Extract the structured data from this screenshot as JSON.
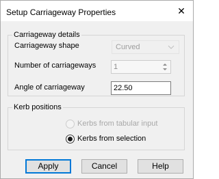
{
  "window": {
    "title": "Setup Carriageway Properties",
    "close_glyph": "✕"
  },
  "carriageway_details": {
    "legend": "Carriageway details",
    "shape_label": "Carriageway shape",
    "shape_value": "Curved",
    "shape_enabled": false,
    "count_label": "Number of carriageways",
    "count_value": "1",
    "count_enabled": false,
    "angle_label": "Angle of carriageway",
    "angle_value": "22.50"
  },
  "kerb_positions": {
    "legend": "Kerb positions",
    "options": [
      {
        "label": "Kerbs from tabular input",
        "selected": false,
        "enabled": false
      },
      {
        "label": "Kerbs from selection",
        "selected": true,
        "enabled": true
      }
    ]
  },
  "buttons": {
    "apply": "Apply",
    "cancel": "Cancel",
    "help": "Help"
  },
  "colors": {
    "dialog_bg": "#f0f0f0",
    "disabled_text": "#9d9d9d",
    "default_button_border": "#0078d7"
  },
  "icons": {
    "close": "close-icon",
    "dropdown": "chevron-down-icon",
    "spin_up": "spin-up-icon",
    "spin_down": "spin-down-icon"
  }
}
